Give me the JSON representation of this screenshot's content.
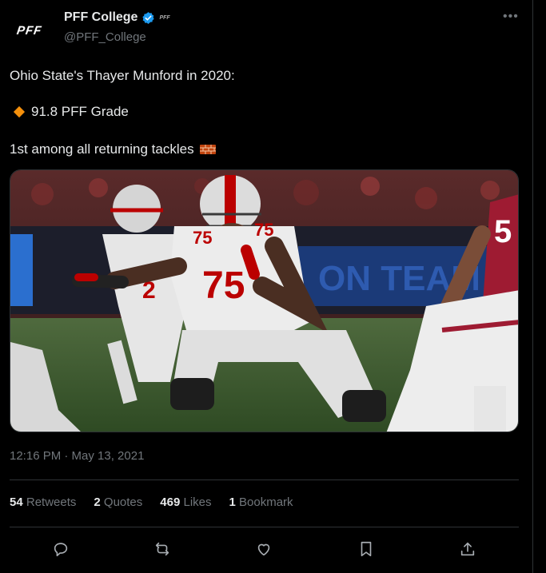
{
  "author": {
    "avatar_text": "PFF",
    "name": "PFF College",
    "affiliate_badge": "PFF",
    "handle": "@PFF_College"
  },
  "tweet": {
    "line1": "Ohio State's Thayer Munford in 2020:",
    "line2": "91.8 PFF Grade",
    "line3": "1st among all returning tackles"
  },
  "photo": {
    "jersey_number": "75",
    "banner_text": "ON TEAM FO"
  },
  "timestamp": "12:16 PM · May 13, 2021",
  "stats": {
    "retweets_count": "54",
    "retweets_label": "Retweets",
    "quotes_count": "2",
    "quotes_label": "Quotes",
    "likes_count": "469",
    "likes_label": "Likes",
    "bookmarks_count": "1",
    "bookmarks_label": "Bookmark"
  },
  "icons": {
    "more": "more-icon",
    "reply": "reply-icon",
    "retweet": "retweet-icon",
    "like": "heart-icon",
    "bookmark": "bookmark-icon",
    "share": "share-icon"
  },
  "colors": {
    "background": "#000000",
    "text": "#e7e9ea",
    "muted": "#71767b",
    "verified": "#1d9bf0",
    "diamond": "#f4900c",
    "scarlet": "#bb0000"
  }
}
